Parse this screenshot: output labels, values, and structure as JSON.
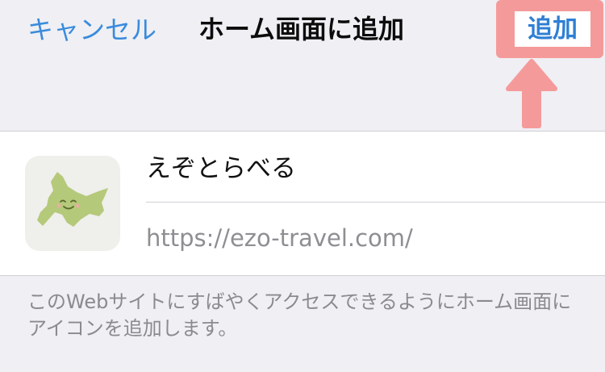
{
  "nav": {
    "cancel_label": "キャンセル",
    "title": "ホーム画面に追加",
    "add_label": "追加"
  },
  "shortcut": {
    "name": "えぞとらべる",
    "url": "https://ezo-travel.com/",
    "icon": "hokkaido-map-icon"
  },
  "description": "このWebサイトにすばやくアクセスできるようにホーム画面にアイコンを追加します。",
  "colors": {
    "link": "#3a8bdc",
    "highlight": "#f59a9a",
    "icon_map": "#b5c97a"
  }
}
